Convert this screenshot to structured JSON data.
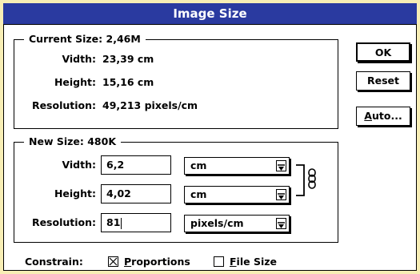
{
  "window": {
    "title": "Image Size"
  },
  "current_size": {
    "legend": "Current Size: 2,46M",
    "width_label": "Vidth:",
    "width_value": "23,39 cm",
    "height_label": "Height:",
    "height_value": "15,16 cm",
    "resolution_label": "Resolution:",
    "resolution_value": "49,213 pixels/cm"
  },
  "new_size": {
    "legend": "New Size: 480K",
    "width_label": "Vidth:",
    "width_value": "6,2",
    "width_unit": "cm",
    "height_label": "Height:",
    "height_value": "4,02",
    "height_unit": "cm",
    "resolution_label": "Resolution:",
    "resolution_value": "81",
    "resolution_unit": "pixels/cm"
  },
  "buttons": {
    "ok": "OK",
    "reset": "Reset",
    "auto": "Auto..."
  },
  "constrain": {
    "label": "Constrain:",
    "proportions_label": "Proportions",
    "proportions_checked": true,
    "filesize_label": "File Size",
    "filesize_checked": false
  },
  "colors": {
    "titlebar": "#2a3aa0",
    "background": "#f8eeb5"
  }
}
